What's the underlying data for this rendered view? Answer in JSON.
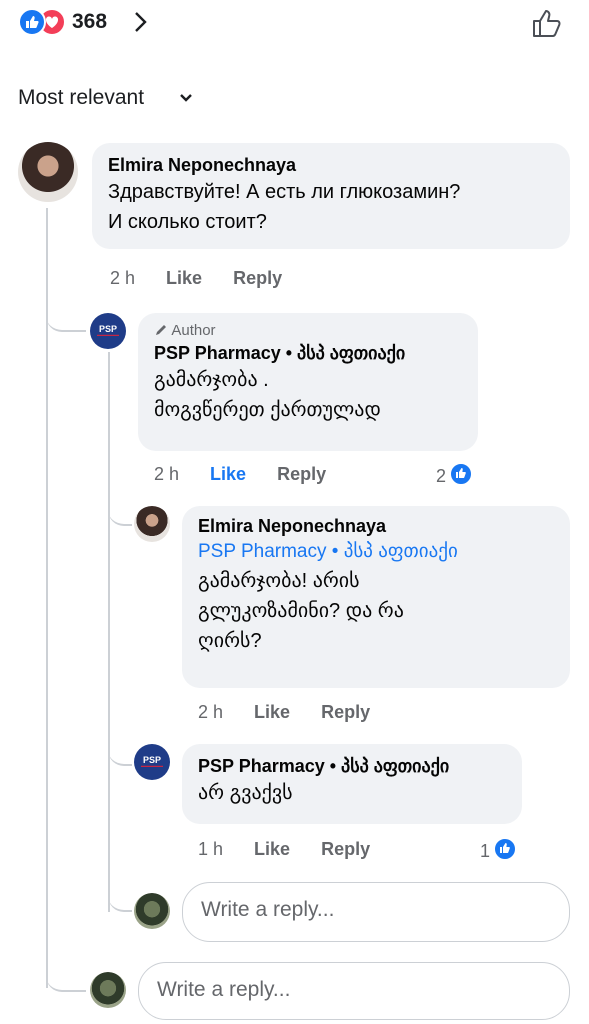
{
  "reactions": {
    "count": "368",
    "like_color": "#1877f2",
    "love_color": "#f33e58"
  },
  "sort": {
    "label": "Most relevant"
  },
  "comments": [
    {
      "author": "Elmira Neponechnaya",
      "text_line1": "Здравствуйте! А есть ли глюкозамин?",
      "text_line2": "И сколько стоит?",
      "time": "2 h",
      "like": "Like",
      "reply": "Reply",
      "replies": [
        {
          "author_badge": "Author",
          "author": "PSP Pharmacy • პსპ აფთიაქი",
          "text_line1": "გამარჯობა .",
          "text_line2": "მოგვწერეთ ქართულად",
          "time": "2 h",
          "like": "Like",
          "reply": "Reply",
          "reactions": "2"
        },
        {
          "author": "Elmira Neponechnaya",
          "tag": "PSP Pharmacy • პსპ აფთიაქი",
          "text_line1": "გამარჯობა! არის",
          "text_line2": "გლუკოზამინი? და რა",
          "text_line3": "ღირს?",
          "time": "2 h",
          "like": "Like",
          "reply": "Reply"
        },
        {
          "author": "PSP Pharmacy • პსპ აფთიაქი",
          "text_line1": "არ გვაქვს",
          "time": "1 h",
          "like": "Like",
          "reply": "Reply",
          "reactions": "1"
        }
      ]
    }
  ],
  "avatar_psp_text": "PSP",
  "reply_placeholder": "Write a reply...",
  "reply_placeholder_main": "Write a reply..."
}
